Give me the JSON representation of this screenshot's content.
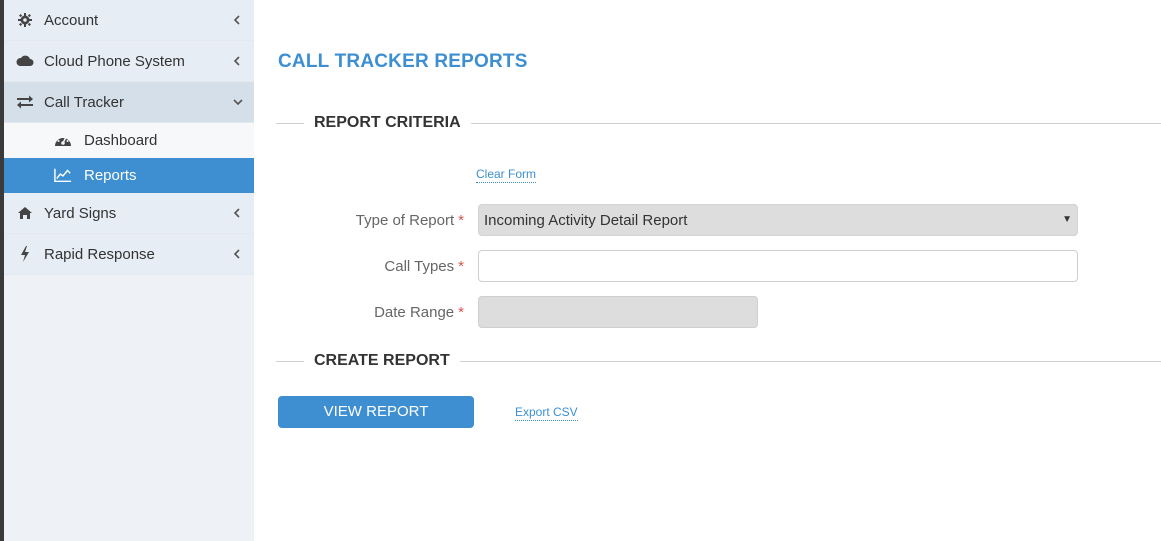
{
  "sidebar": {
    "items": [
      {
        "label": "Account",
        "icon": "gear-icon"
      },
      {
        "label": "Cloud Phone System",
        "icon": "cloud-icon"
      },
      {
        "label": "Call Tracker",
        "icon": "exchange-arrows-icon"
      },
      {
        "label": "Yard Signs",
        "icon": "home-icon"
      },
      {
        "label": "Rapid Response",
        "icon": "bolt-icon"
      }
    ],
    "sub_items": [
      {
        "label": "Dashboard",
        "icon": "dashboard-gauge-icon"
      },
      {
        "label": "Reports",
        "icon": "line-chart-icon"
      }
    ]
  },
  "page": {
    "title": "CALL TRACKER REPORTS",
    "criteria_title": "REPORT CRITERIA",
    "create_title": "CREATE REPORT",
    "clear_form": "Clear Form",
    "export_csv": "Export CSV",
    "view_report": "VIEW REPORT"
  },
  "form": {
    "type_label": "Type of Report",
    "type_value": "Incoming Activity Detail Report",
    "call_types_label": "Call Types",
    "call_types_value": "",
    "date_range_label": "Date Range",
    "date_range_value": "",
    "required_mark": "*"
  },
  "colors": {
    "accent": "#3d8fd1",
    "required": "#d9534f"
  }
}
